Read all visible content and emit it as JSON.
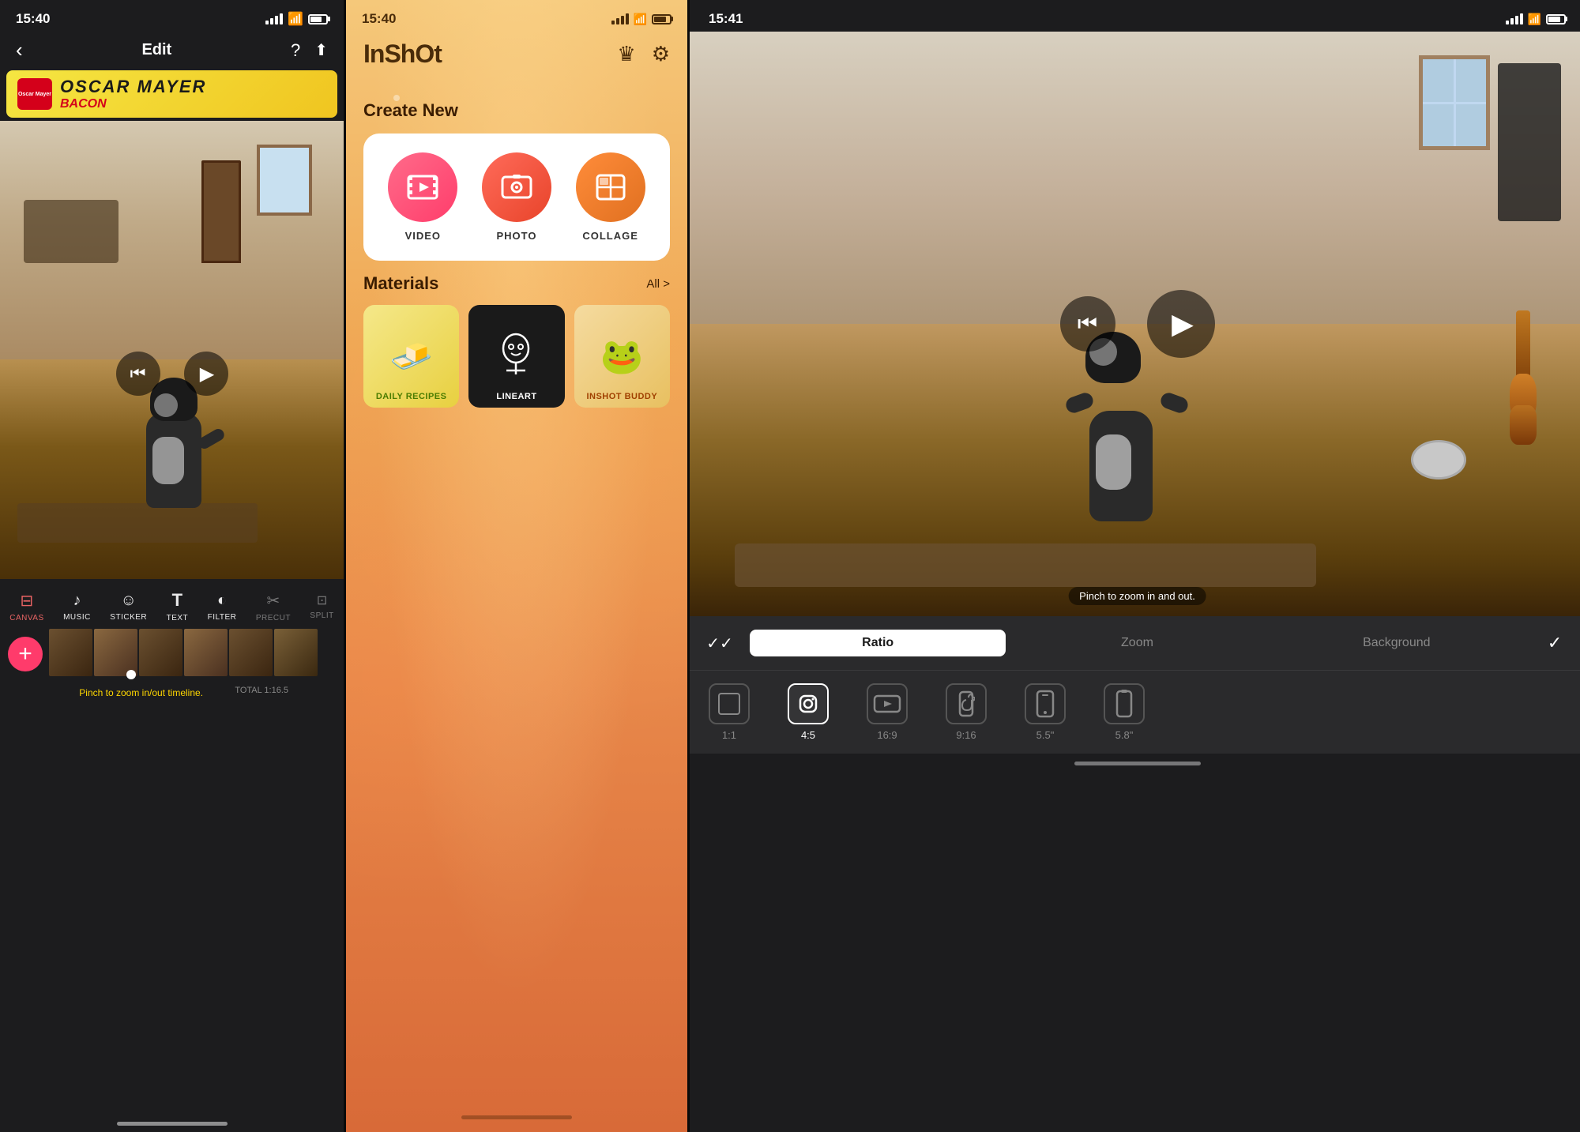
{
  "panel1": {
    "status": {
      "time": "15:40",
      "location": "▲"
    },
    "nav": {
      "title": "Edit",
      "back": "‹",
      "help": "?",
      "share": "⬆"
    },
    "ad": {
      "brand": "Oscar Mayer",
      "text1": "OSCAR  MAYER",
      "text2": "BACON"
    },
    "controls": {
      "skip_back": "⏮",
      "play": "▶"
    },
    "toolbar": [
      {
        "id": "canvas",
        "icon": "≡",
        "label": "CANVAS",
        "active": true
      },
      {
        "id": "music",
        "icon": "♪",
        "label": "MUSIC",
        "active": false
      },
      {
        "id": "sticker",
        "icon": "☺",
        "label": "STICKER",
        "active": false
      },
      {
        "id": "text",
        "icon": "T",
        "label": "TEXT",
        "active": false
      },
      {
        "id": "filter",
        "icon": "◐",
        "label": "FILTER",
        "active": false
      },
      {
        "id": "precut",
        "icon": "✂",
        "label": "PRECUT",
        "active": false,
        "dim": true
      },
      {
        "id": "split",
        "icon": "⊡",
        "label": "SPLIT",
        "active": false,
        "dim": true
      }
    ],
    "timeline": {
      "add": "+",
      "total": "TOTAL 1:16.5"
    },
    "pinch_hint": "Pinch to zoom in/out timeline."
  },
  "panel2": {
    "status": {
      "time": "15:40"
    },
    "header": {
      "logo": "InShOt",
      "crown": "♛",
      "gear": "⚙"
    },
    "create": {
      "title": "Create New",
      "items": [
        {
          "id": "video",
          "label": "VIDEO",
          "icon": "▶▐"
        },
        {
          "id": "photo",
          "label": "PHOTO",
          "icon": "🖼"
        },
        {
          "id": "collage",
          "label": "COLLAGE",
          "icon": "⊞"
        }
      ]
    },
    "materials": {
      "title": "Materials",
      "all_label": "All >",
      "items": [
        {
          "id": "daily",
          "label": "DAILY RECIPES",
          "emoji": "🧈",
          "class": "mat-daily"
        },
        {
          "id": "lineart",
          "label": "LINEART",
          "emoji": "👤",
          "class": "mat-lineart"
        },
        {
          "id": "buddy",
          "label": "INSHOT BUDDY",
          "emoji": "🐸",
          "class": "mat-buddy"
        }
      ]
    }
  },
  "panel3": {
    "status": {
      "time": "15:41",
      "location": "▲"
    },
    "pinch_hint": "Pinch to zoom in and out.",
    "controls": {
      "skip_back": "⏮",
      "play": "▶"
    },
    "ratio_toolbar": {
      "double_check": "✓✓",
      "tabs": [
        {
          "id": "ratio",
          "label": "Ratio",
          "active": true
        },
        {
          "id": "zoom",
          "label": "Zoom",
          "active": false
        },
        {
          "id": "background",
          "label": "Background",
          "active": false
        }
      ],
      "confirm": "✓"
    },
    "ratio_options": [
      {
        "id": "1:1",
        "label": "1:1",
        "selected": false
      },
      {
        "id": "4:5",
        "label": "4:5",
        "selected": true
      },
      {
        "id": "16:9",
        "label": "16:9",
        "selected": false
      },
      {
        "id": "9:16",
        "label": "9:16",
        "selected": false
      },
      {
        "id": "5.5in",
        "label": "5.5\"",
        "selected": false
      },
      {
        "id": "5.8in",
        "label": "5.8\"",
        "selected": false
      }
    ]
  }
}
